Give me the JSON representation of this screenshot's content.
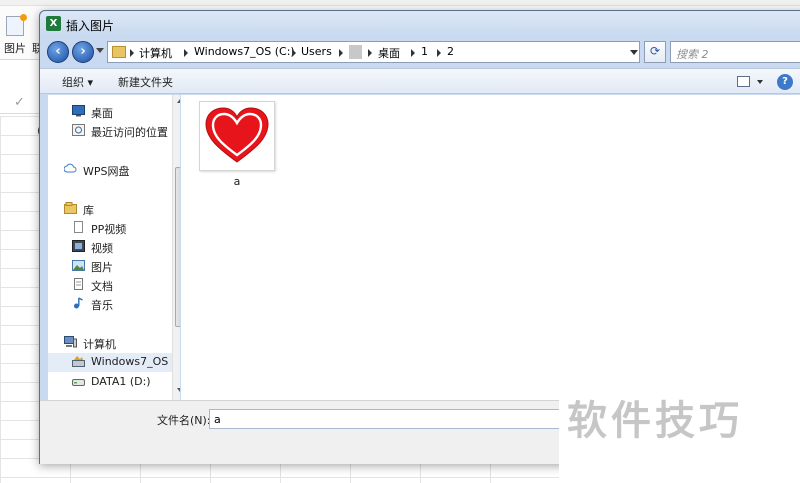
{
  "background": {
    "ribbon": {
      "picture_label": "图片",
      "next_label": "联"
    },
    "cell_char": "("
  },
  "dialog": {
    "title": "插入图片",
    "app_icon": "excel-icon",
    "address": {
      "crumbs": [
        "计算机",
        "Windows7_OS (C:)",
        "Users",
        "桌面",
        "1",
        "2"
      ]
    },
    "search": {
      "placeholder": "搜索 2"
    },
    "toolbar": {
      "organize": "组织 ▾",
      "new_folder": "新建文件夹"
    },
    "nav": {
      "items": [
        {
          "label": "桌面",
          "icon": "desktop-icon"
        },
        {
          "label": "最近访问的位置",
          "icon": "recent-places-icon"
        },
        {
          "label": "WPS网盘",
          "icon": "cloud-icon"
        },
        {
          "label": "库",
          "icon": "library-icon"
        },
        {
          "label": "PP视频",
          "icon": "document-icon"
        },
        {
          "label": "视频",
          "icon": "video-icon"
        },
        {
          "label": "图片",
          "icon": "pictures-icon"
        },
        {
          "label": "文档",
          "icon": "documents-icon"
        },
        {
          "label": "音乐",
          "icon": "music-icon"
        },
        {
          "label": "计算机",
          "icon": "computer-icon"
        },
        {
          "label": "Windows7_OS (",
          "icon": "drive-icon",
          "selected": true
        },
        {
          "label": "DATA1 (D:)",
          "icon": "drive-icon"
        }
      ]
    },
    "files": [
      {
        "name": "a",
        "thumbnail": "heart-icon"
      }
    ],
    "filename": {
      "label": "文件名(N):",
      "value": "a"
    }
  },
  "watermark": "软件技巧",
  "colors": {
    "heart": "#e8141b",
    "dialog_frame": "#c9daf0"
  }
}
